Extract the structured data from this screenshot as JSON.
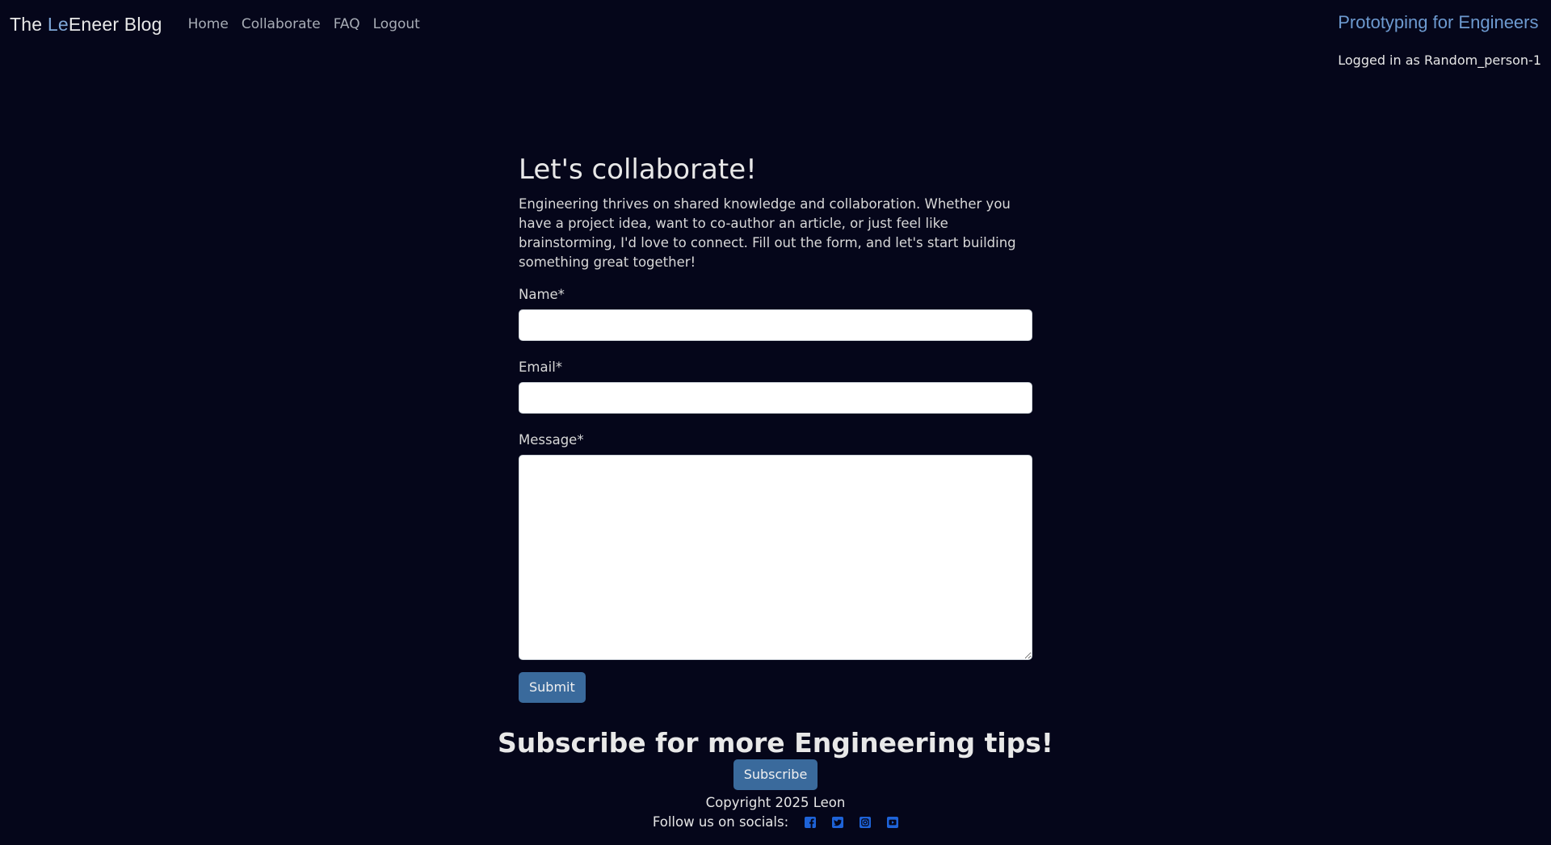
{
  "navbar": {
    "brand_prefix": "The ",
    "brand_accent": "Le",
    "brand_suffix": "Eneer Blog",
    "links": [
      "Home",
      "Collaborate",
      "FAQ",
      "Logout"
    ],
    "topic_link": "Prototyping for Engineers",
    "logged_in_text": "Logged in as Random_person-1"
  },
  "main": {
    "title": "Let's collaborate!",
    "intro": "Engineering thrives on shared knowledge and collaboration. Whether you have a project idea, want to co-author an article, or just feel like brainstorming, I'd love to connect. Fill out the form, and let's start building something great together!",
    "form": {
      "name_label": "Name*",
      "name_value": "",
      "email_label": "Email*",
      "email_value": "",
      "message_label": "Message*",
      "message_value": "",
      "submit_label": "Submit"
    }
  },
  "footer": {
    "subscribe_title": "Subscribe for more Engineering tips!",
    "subscribe_label": "Subscribe",
    "copyright": "Copyright 2025 Leon",
    "socials_label": "Follow us on socials:",
    "social_icons": [
      "facebook-icon",
      "twitter-icon",
      "instagram-icon",
      "youtube-icon"
    ]
  },
  "colors": {
    "background": "#05061a",
    "accent": "#6d9ad0",
    "button": "#3a6a9c",
    "social_icon": "#1e63d8"
  }
}
